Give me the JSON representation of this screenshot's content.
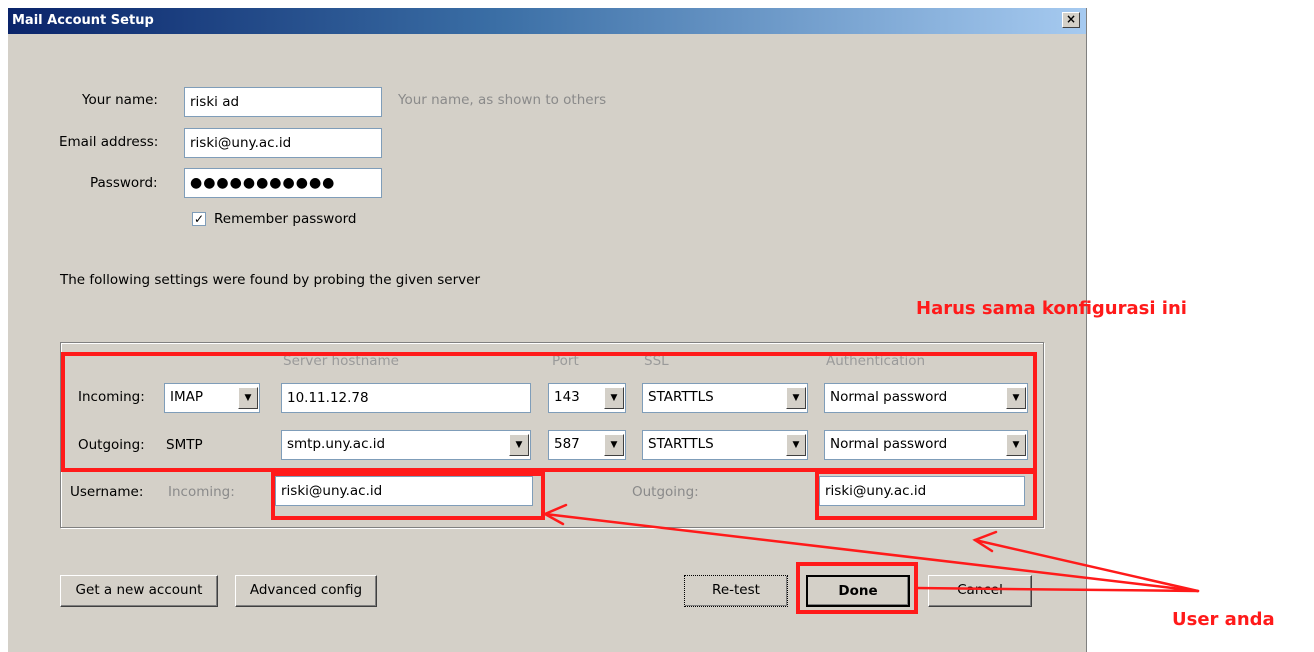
{
  "window": {
    "title": "Mail Account Setup",
    "close_glyph": "×"
  },
  "fields": {
    "name_label": "Your name:",
    "name_value": "riski ad",
    "name_hint": "Your name, as shown to others",
    "email_label": "Email address:",
    "email_value": "riski@uny.ac.id",
    "password_label": "Password:",
    "password_value": "●●●●●●●●●●●",
    "remember_label": "Remember password",
    "remember_checked": true
  },
  "probe_message": "The following settings were found by probing the given server",
  "server": {
    "headers": {
      "hostname": "Server hostname",
      "port": "Port",
      "ssl": "SSL",
      "auth": "Authentication"
    },
    "incoming": {
      "label": "Incoming:",
      "protocol": "IMAP",
      "hostname": "10.11.12.78",
      "port": "143",
      "ssl": "STARTTLS",
      "auth": "Normal password"
    },
    "outgoing": {
      "label": "Outgoing:",
      "protocol": "SMTP",
      "hostname": "smtp.uny.ac.id",
      "port": "587",
      "ssl": "STARTTLS",
      "auth": "Normal password"
    },
    "username": {
      "label": "Username:",
      "incoming_label": "Incoming:",
      "incoming_value": "riski@uny.ac.id",
      "outgoing_label": "Outgoing:",
      "outgoing_value": "riski@uny.ac.id"
    }
  },
  "buttons": {
    "new_account": "Get a new account",
    "advanced": "Advanced config",
    "retest": "Re-test",
    "done": "Done",
    "cancel": "Cancel"
  },
  "annotations": {
    "config_note": "Harus sama konfigurasi ini",
    "user_note": "User anda",
    "color": "#ff1a1a"
  }
}
